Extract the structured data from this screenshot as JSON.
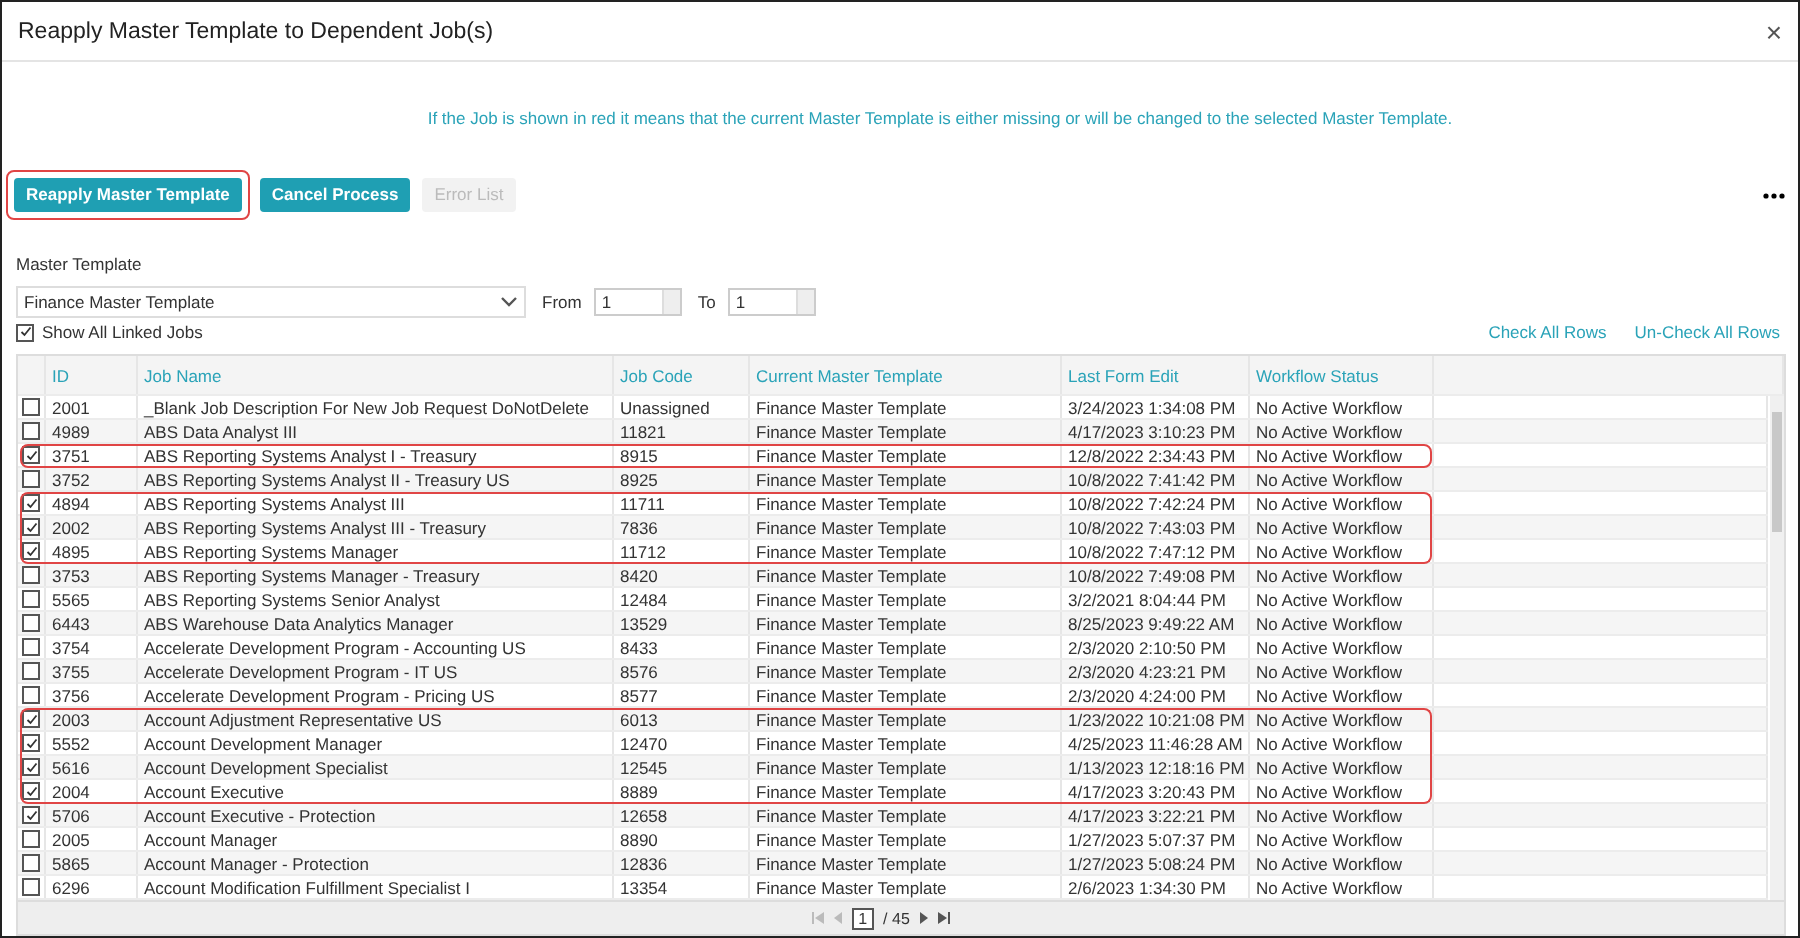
{
  "window": {
    "title": "Reapply Master Template to Dependent Job(s)",
    "close": "×"
  },
  "info": "If the Job is shown in red it means that the current Master Template is either missing or will be changed to the selected Master Template.",
  "buttons": [
    {
      "label": "Reapply Master Template",
      "disabled": false,
      "outlined": true
    },
    {
      "label": "Cancel Process",
      "disabled": false,
      "outlined": false
    },
    {
      "label": "Error List",
      "disabled": true,
      "outlined": false
    }
  ],
  "master_template": {
    "label": "Master Template",
    "value": "Finance Master Template",
    "from_label": "From",
    "from": "1",
    "to_label": "To",
    "to": "1"
  },
  "show_all": {
    "label": "Show All Linked Jobs",
    "checked": true
  },
  "links": [
    "Check All Rows",
    "Un-Check All Rows"
  ],
  "table": {
    "columns": [
      "ID",
      "Job Name",
      "Job Code",
      "Current Master Template",
      "Last Form Edit",
      "Workflow Status"
    ],
    "rows": [
      {
        "id": "2001",
        "name": "_Blank Job Description For New Job Request DoNotDelete",
        "code": "Unassigned",
        "template": "Finance Master Template",
        "edited": "3/24/2023 1:34:08 PM",
        "status": "No Active Workflow",
        "checked": false,
        "outlined": false
      },
      {
        "id": "4989",
        "name": "ABS Data Analyst III",
        "code": "11821",
        "template": "Finance Master Template",
        "edited": "4/17/2023 3:10:23 PM",
        "status": "No Active Workflow",
        "checked": false,
        "outlined": false
      },
      {
        "id": "3751",
        "name": "ABS Reporting Systems Analyst I - Treasury",
        "code": "8915",
        "template": "Finance Master Template",
        "edited": "12/8/2022 2:34:43 PM",
        "status": "No Active Workflow",
        "checked": true,
        "outlined": true
      },
      {
        "id": "3752",
        "name": "ABS Reporting Systems Analyst II - Treasury US",
        "code": "8925",
        "template": "Finance Master Template",
        "edited": "10/8/2022 7:41:42 PM",
        "status": "No Active Workflow",
        "checked": false,
        "outlined": false
      },
      {
        "id": "4894",
        "name": "ABS Reporting Systems Analyst III",
        "code": "11711",
        "template": "Finance Master Template",
        "edited": "10/8/2022 7:42:24 PM",
        "status": "No Active Workflow",
        "checked": true,
        "outlined": true
      },
      {
        "id": "2002",
        "name": "ABS Reporting Systems Analyst III - Treasury",
        "code": "7836",
        "template": "Finance Master Template",
        "edited": "10/8/2022 7:43:03 PM",
        "status": "No Active Workflow",
        "checked": true,
        "outlined": true
      },
      {
        "id": "4895",
        "name": "ABS Reporting Systems Manager",
        "code": "11712",
        "template": "Finance Master Template",
        "edited": "10/8/2022 7:47:12 PM",
        "status": "No Active Workflow",
        "checked": true,
        "outlined": true
      },
      {
        "id": "3753",
        "name": "ABS Reporting Systems Manager - Treasury",
        "code": "8420",
        "template": "Finance Master Template",
        "edited": "10/8/2022 7:49:08 PM",
        "status": "No Active Workflow",
        "checked": false,
        "outlined": false
      },
      {
        "id": "5565",
        "name": "ABS Reporting Systems Senior Analyst",
        "code": "12484",
        "template": "Finance Master Template",
        "edited": "3/2/2021 8:04:44 PM",
        "status": "No Active Workflow",
        "checked": false,
        "outlined": false
      },
      {
        "id": "6443",
        "name": "ABS Warehouse Data Analytics Manager",
        "code": "13529",
        "template": "Finance Master Template",
        "edited": "8/25/2023 9:49:22 AM",
        "status": "No Active Workflow",
        "checked": false,
        "outlined": false
      },
      {
        "id": "3754",
        "name": "Accelerate Development Program - Accounting US",
        "code": "8433",
        "template": "Finance Master Template",
        "edited": "2/3/2020 2:10:50 PM",
        "status": "No Active Workflow",
        "checked": false,
        "outlined": false
      },
      {
        "id": "3755",
        "name": "Accelerate Development Program - IT US",
        "code": "8576",
        "template": "Finance Master Template",
        "edited": "2/3/2020 4:23:21 PM",
        "status": "No Active Workflow",
        "checked": false,
        "outlined": false
      },
      {
        "id": "3756",
        "name": "Accelerate Development Program - Pricing US",
        "code": "8577",
        "template": "Finance Master Template",
        "edited": "2/3/2020 4:24:00 PM",
        "status": "No Active Workflow",
        "checked": false,
        "outlined": false
      },
      {
        "id": "2003",
        "name": "Account Adjustment Representative US",
        "code": "6013",
        "template": "Finance Master Template",
        "edited": "1/23/2022 10:21:08 PM",
        "status": "No Active Workflow",
        "checked": true,
        "outlined": true
      },
      {
        "id": "5552",
        "name": "Account Development Manager",
        "code": "12470",
        "template": "Finance Master Template",
        "edited": "4/25/2023 11:46:28 AM",
        "status": "No Active Workflow",
        "checked": true,
        "outlined": true
      },
      {
        "id": "5616",
        "name": "Account Development Specialist",
        "code": "12545",
        "template": "Finance Master Template",
        "edited": "1/13/2023 12:18:16 PM",
        "status": "No Active Workflow",
        "checked": true,
        "outlined": true
      },
      {
        "id": "2004",
        "name": "Account Executive",
        "code": "8889",
        "template": "Finance Master Template",
        "edited": "4/17/2023 3:20:43 PM",
        "status": "No Active Workflow",
        "checked": true,
        "outlined": true
      },
      {
        "id": "5706",
        "name": "Account Executive - Protection",
        "code": "12658",
        "template": "Finance Master Template",
        "edited": "4/17/2023 3:22:21 PM",
        "status": "No Active Workflow",
        "checked": true,
        "outlined": false
      },
      {
        "id": "2005",
        "name": "Account Manager",
        "code": "8890",
        "template": "Finance Master Template",
        "edited": "1/27/2023 5:07:37 PM",
        "status": "No Active Workflow",
        "checked": false,
        "outlined": false
      },
      {
        "id": "5865",
        "name": "Account Manager - Protection",
        "code": "12836",
        "template": "Finance Master Template",
        "edited": "1/27/2023 5:08:24 PM",
        "status": "No Active Workflow",
        "checked": false,
        "outlined": false
      },
      {
        "id": "6296",
        "name": "Account Modification Fulfillment Specialist I",
        "code": "13354",
        "template": "Finance Master Template",
        "edited": "2/6/2023 1:34:30 PM",
        "status": "No Active Workflow",
        "checked": false,
        "outlined": false
      }
    ]
  },
  "pager": {
    "page": "1",
    "total": "/ 45"
  }
}
